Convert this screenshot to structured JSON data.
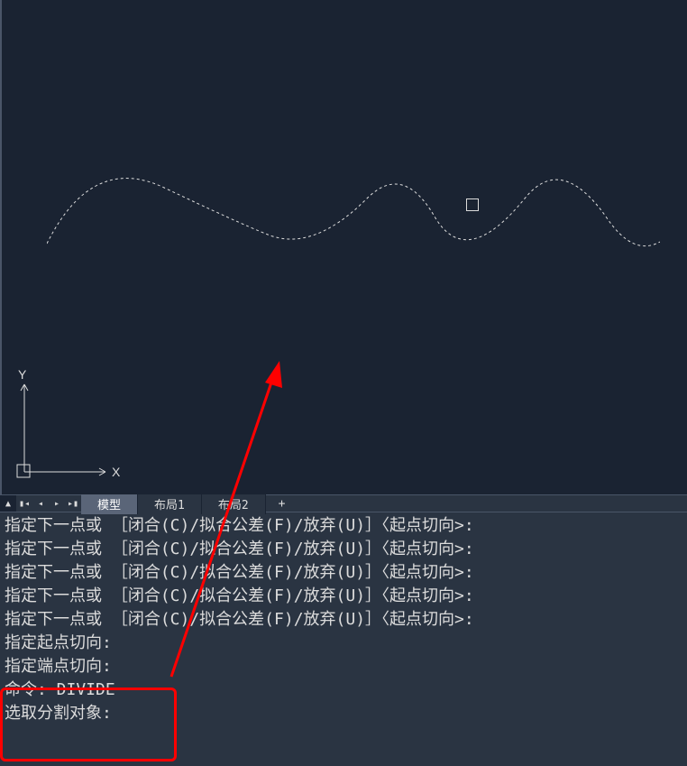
{
  "tabs": {
    "model": "模型",
    "layout1": "布局1",
    "layout2": "布局2",
    "add": "+"
  },
  "ucs": {
    "x_label": "X",
    "y_label": "Y"
  },
  "command_lines": {
    "l1": "指定下一点或 ［闭合(C)/拟合公差(F)/放弃(U)］〈起点切向>:",
    "l2": "指定下一点或 ［闭合(C)/拟合公差(F)/放弃(U)］〈起点切向>:",
    "l3": "指定下一点或 ［闭合(C)/拟合公差(F)/放弃(U)］〈起点切向>:",
    "l4": "指定下一点或 ［闭合(C)/拟合公差(F)/放弃(U)］〈起点切向>:",
    "l5": "指定下一点或 ［闭合(C)/拟合公差(F)/放弃(U)］〈起点切向>:",
    "l6": "指定起点切向:",
    "l7": "指定端点切向:",
    "l8": "命令: DIVIDE",
    "l9": "",
    "l10": "选取分割对象:"
  }
}
